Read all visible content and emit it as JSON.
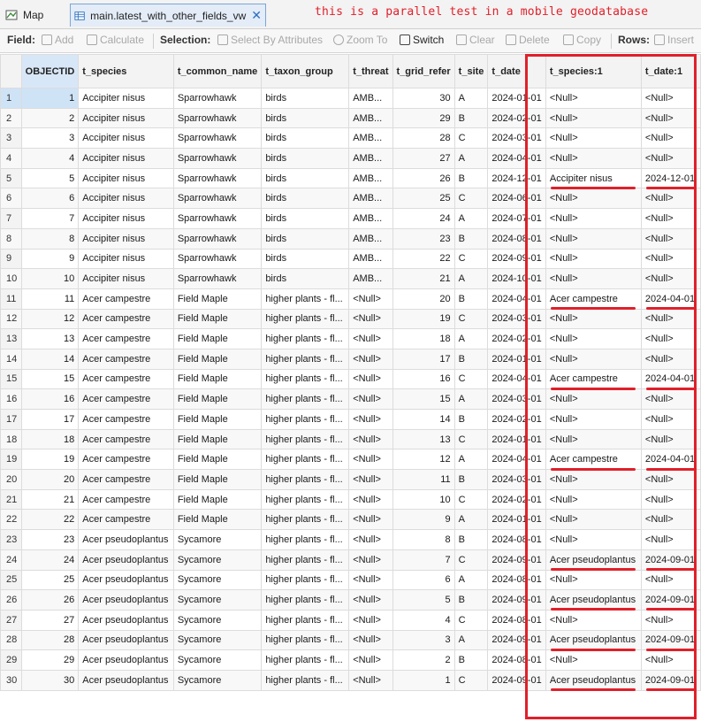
{
  "tabs": {
    "map_label": "Map",
    "table_label": "main.latest_with_other_fields_vw",
    "close_glyph": "✕"
  },
  "annotation_note": "this is a parallel test in a mobile geodatabase",
  "toolbar": {
    "field_label": "Field:",
    "add": "Add",
    "calculate": "Calculate",
    "selection_label": "Selection:",
    "select_by_attributes": "Select By Attributes",
    "zoom_to": "Zoom To",
    "switch": "Switch",
    "clear": "Clear",
    "delete": "Delete",
    "copy": "Copy",
    "rows_label": "Rows:",
    "insert": "Insert"
  },
  "table": {
    "columns": [
      "",
      "OBJECTID",
      "t_species",
      "t_common_name",
      "t_taxon_group",
      "t_threat",
      "t_grid_refer",
      "t_site",
      "t_date",
      "t_species:1",
      "t_date:1"
    ],
    "rows": [
      [
        "1",
        "1",
        "Accipiter nisus",
        "Sparrowhawk",
        "birds",
        "AMB...",
        "30",
        "A",
        "2024-01-01",
        "<Null>",
        "<Null>"
      ],
      [
        "2",
        "2",
        "Accipiter nisus",
        "Sparrowhawk",
        "birds",
        "AMB...",
        "29",
        "B",
        "2024-02-01",
        "<Null>",
        "<Null>"
      ],
      [
        "3",
        "3",
        "Accipiter nisus",
        "Sparrowhawk",
        "birds",
        "AMB...",
        "28",
        "C",
        "2024-03-01",
        "<Null>",
        "<Null>"
      ],
      [
        "4",
        "4",
        "Accipiter nisus",
        "Sparrowhawk",
        "birds",
        "AMB...",
        "27",
        "A",
        "2024-04-01",
        "<Null>",
        "<Null>"
      ],
      [
        "5",
        "5",
        "Accipiter nisus",
        "Sparrowhawk",
        "birds",
        "AMB...",
        "26",
        "B",
        "2024-12-01",
        "Accipiter nisus",
        "2024-12-01"
      ],
      [
        "6",
        "6",
        "Accipiter nisus",
        "Sparrowhawk",
        "birds",
        "AMB...",
        "25",
        "C",
        "2024-06-01",
        "<Null>",
        "<Null>"
      ],
      [
        "7",
        "7",
        "Accipiter nisus",
        "Sparrowhawk",
        "birds",
        "AMB...",
        "24",
        "A",
        "2024-07-01",
        "<Null>",
        "<Null>"
      ],
      [
        "8",
        "8",
        "Accipiter nisus",
        "Sparrowhawk",
        "birds",
        "AMB...",
        "23",
        "B",
        "2024-08-01",
        "<Null>",
        "<Null>"
      ],
      [
        "9",
        "9",
        "Accipiter nisus",
        "Sparrowhawk",
        "birds",
        "AMB...",
        "22",
        "C",
        "2024-09-01",
        "<Null>",
        "<Null>"
      ],
      [
        "10",
        "10",
        "Accipiter nisus",
        "Sparrowhawk",
        "birds",
        "AMB...",
        "21",
        "A",
        "2024-10-01",
        "<Null>",
        "<Null>"
      ],
      [
        "11",
        "11",
        "Acer campestre",
        "Field Maple",
        "higher plants - fl...",
        "<Null>",
        "20",
        "B",
        "2024-04-01",
        "Acer campestre",
        "2024-04-01"
      ],
      [
        "12",
        "12",
        "Acer campestre",
        "Field Maple",
        "higher plants - fl...",
        "<Null>",
        "19",
        "C",
        "2024-03-01",
        "<Null>",
        "<Null>"
      ],
      [
        "13",
        "13",
        "Acer campestre",
        "Field Maple",
        "higher plants - fl...",
        "<Null>",
        "18",
        "A",
        "2024-02-01",
        "<Null>",
        "<Null>"
      ],
      [
        "14",
        "14",
        "Acer campestre",
        "Field Maple",
        "higher plants - fl...",
        "<Null>",
        "17",
        "B",
        "2024-01-01",
        "<Null>",
        "<Null>"
      ],
      [
        "15",
        "15",
        "Acer campestre",
        "Field Maple",
        "higher plants - fl...",
        "<Null>",
        "16",
        "C",
        "2024-04-01",
        "Acer campestre",
        "2024-04-01"
      ],
      [
        "16",
        "16",
        "Acer campestre",
        "Field Maple",
        "higher plants - fl...",
        "<Null>",
        "15",
        "A",
        "2024-03-01",
        "<Null>",
        "<Null>"
      ],
      [
        "17",
        "17",
        "Acer campestre",
        "Field Maple",
        "higher plants - fl...",
        "<Null>",
        "14",
        "B",
        "2024-02-01",
        "<Null>",
        "<Null>"
      ],
      [
        "18",
        "18",
        "Acer campestre",
        "Field Maple",
        "higher plants - fl...",
        "<Null>",
        "13",
        "C",
        "2024-01-01",
        "<Null>",
        "<Null>"
      ],
      [
        "19",
        "19",
        "Acer campestre",
        "Field Maple",
        "higher plants - fl...",
        "<Null>",
        "12",
        "A",
        "2024-04-01",
        "Acer campestre",
        "2024-04-01"
      ],
      [
        "20",
        "20",
        "Acer campestre",
        "Field Maple",
        "higher plants - fl...",
        "<Null>",
        "11",
        "B",
        "2024-03-01",
        "<Null>",
        "<Null>"
      ],
      [
        "21",
        "21",
        "Acer campestre",
        "Field Maple",
        "higher plants - fl...",
        "<Null>",
        "10",
        "C",
        "2024-02-01",
        "<Null>",
        "<Null>"
      ],
      [
        "22",
        "22",
        "Acer campestre",
        "Field Maple",
        "higher plants - fl...",
        "<Null>",
        "9",
        "A",
        "2024-01-01",
        "<Null>",
        "<Null>"
      ],
      [
        "23",
        "23",
        "Acer pseudoplantus",
        "Sycamore",
        "higher plants - fl...",
        "<Null>",
        "8",
        "B",
        "2024-08-01",
        "<Null>",
        "<Null>"
      ],
      [
        "24",
        "24",
        "Acer pseudoplantus",
        "Sycamore",
        "higher plants - fl...",
        "<Null>",
        "7",
        "C",
        "2024-09-01",
        "Acer pseudoplantus",
        "2024-09-01"
      ],
      [
        "25",
        "25",
        "Acer pseudoplantus",
        "Sycamore",
        "higher plants - fl...",
        "<Null>",
        "6",
        "A",
        "2024-08-01",
        "<Null>",
        "<Null>"
      ],
      [
        "26",
        "26",
        "Acer pseudoplantus",
        "Sycamore",
        "higher plants - fl...",
        "<Null>",
        "5",
        "B",
        "2024-09-01",
        "Acer pseudoplantus",
        "2024-09-01"
      ],
      [
        "27",
        "27",
        "Acer pseudoplantus",
        "Sycamore",
        "higher plants - fl...",
        "<Null>",
        "4",
        "C",
        "2024-08-01",
        "<Null>",
        "<Null>"
      ],
      [
        "28",
        "28",
        "Acer pseudoplantus",
        "Sycamore",
        "higher plants - fl...",
        "<Null>",
        "3",
        "A",
        "2024-09-01",
        "Acer pseudoplantus",
        "2024-09-01"
      ],
      [
        "29",
        "29",
        "Acer pseudoplantus",
        "Sycamore",
        "higher plants - fl...",
        "<Null>",
        "2",
        "B",
        "2024-08-01",
        "<Null>",
        "<Null>"
      ],
      [
        "30",
        "30",
        "Acer pseudoplantus",
        "Sycamore",
        "higher plants - fl...",
        "<Null>",
        "1",
        "C",
        "2024-09-01",
        "Acer pseudoplantus",
        "2024-09-01"
      ]
    ]
  },
  "colors": {
    "annotation_red": "#e0202a",
    "selected_row": "#cfe3f7"
  }
}
